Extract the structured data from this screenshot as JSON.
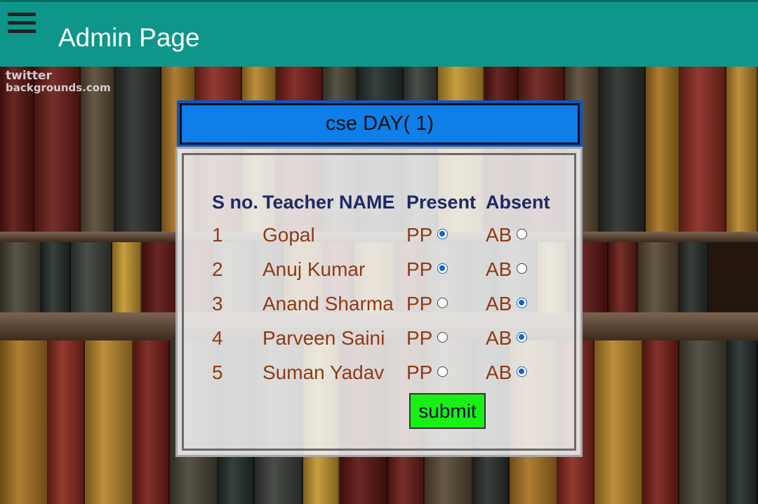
{
  "appbar": {
    "title": "Admin Page",
    "menu_icon": "hamburger-menu-icon",
    "color": "#0f968a"
  },
  "background": {
    "watermark_line1": "twitter",
    "watermark_line2": "backgrounds.com"
  },
  "attendance": {
    "header": "cse DAY( 1)",
    "columns": {
      "sno": "S no.",
      "name": "Teacher NAME",
      "present": "Present",
      "absent": "Absent"
    },
    "present_label": "PP",
    "absent_label": "AB",
    "rows": [
      {
        "sno": "1",
        "name": "Gopal",
        "status": "present"
      },
      {
        "sno": "2",
        "name": "Anuj Kumar",
        "status": "present"
      },
      {
        "sno": "3",
        "name": "Anand Sharma",
        "status": "absent"
      },
      {
        "sno": "4",
        "name": "Parveen Saini",
        "status": "absent"
      },
      {
        "sno": "5",
        "name": "Suman Yadav",
        "status": "absent"
      }
    ],
    "submit_label": "submit",
    "colors": {
      "header_bg": "#0f7ee8",
      "submit_bg": "#19f013",
      "name_text": "#8e3a14",
      "column_header_text": "#1d2a66"
    }
  }
}
